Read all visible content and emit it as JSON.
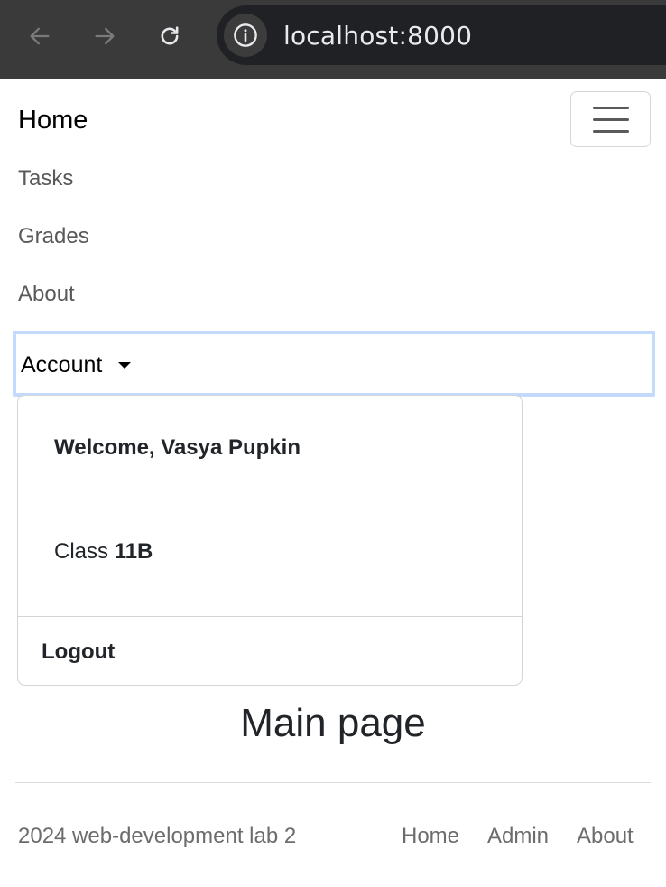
{
  "browser": {
    "url": "localhost:8000",
    "back_icon": "arrow-left-icon",
    "forward_icon": "arrow-right-icon",
    "reload_icon": "reload-icon",
    "site_info_icon": "info-icon"
  },
  "navbar": {
    "brand": "Home",
    "toggler_icon": "hamburger-menu-icon",
    "links": [
      "Tasks",
      "Grades",
      "About"
    ],
    "account_label": "Account",
    "dropdown": {
      "welcome": "Welcome, Vasya Pupkin",
      "class_prefix": "Class",
      "class_value": "11B",
      "logout": "Logout"
    }
  },
  "main": {
    "title": "Main page"
  },
  "footer": {
    "text": "2024 web-development lab 2",
    "links": [
      "Home",
      "Admin",
      "About"
    ]
  },
  "colors": {
    "focus_ring": "#c4dafc",
    "browser_chrome": "#3a3a3a",
    "text_dark": "#212529",
    "text_muted": "#595959"
  }
}
